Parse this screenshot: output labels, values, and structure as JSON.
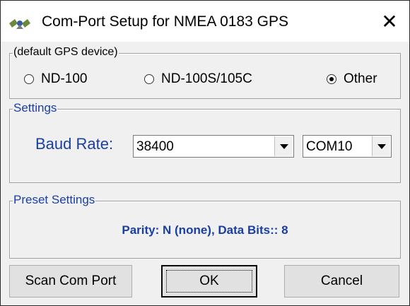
{
  "window": {
    "title": "Com-Port Setup for NMEA 0183 GPS",
    "close_glyph": "✕",
    "icon": "satellite-icon"
  },
  "device_group": {
    "legend": "(default GPS device)",
    "options": [
      {
        "label": "ND-100",
        "checked": false
      },
      {
        "label": "ND-100S/105C",
        "checked": false
      },
      {
        "label": "Other",
        "checked": true
      }
    ]
  },
  "settings_group": {
    "legend": "Settings",
    "baud_label": "Baud Rate:",
    "baud_value": "38400",
    "com_value": "COM10"
  },
  "preset_group": {
    "legend": "Preset Settings",
    "text": "Parity: N (none), Data Bits:: 8"
  },
  "buttons": {
    "scan": "Scan Com Port",
    "ok": "OK",
    "cancel": "Cancel"
  },
  "colors": {
    "accent_text": "#1a3fa3",
    "window_bg": "#f0f0f0",
    "titlebar_bg": "#ffffff"
  }
}
